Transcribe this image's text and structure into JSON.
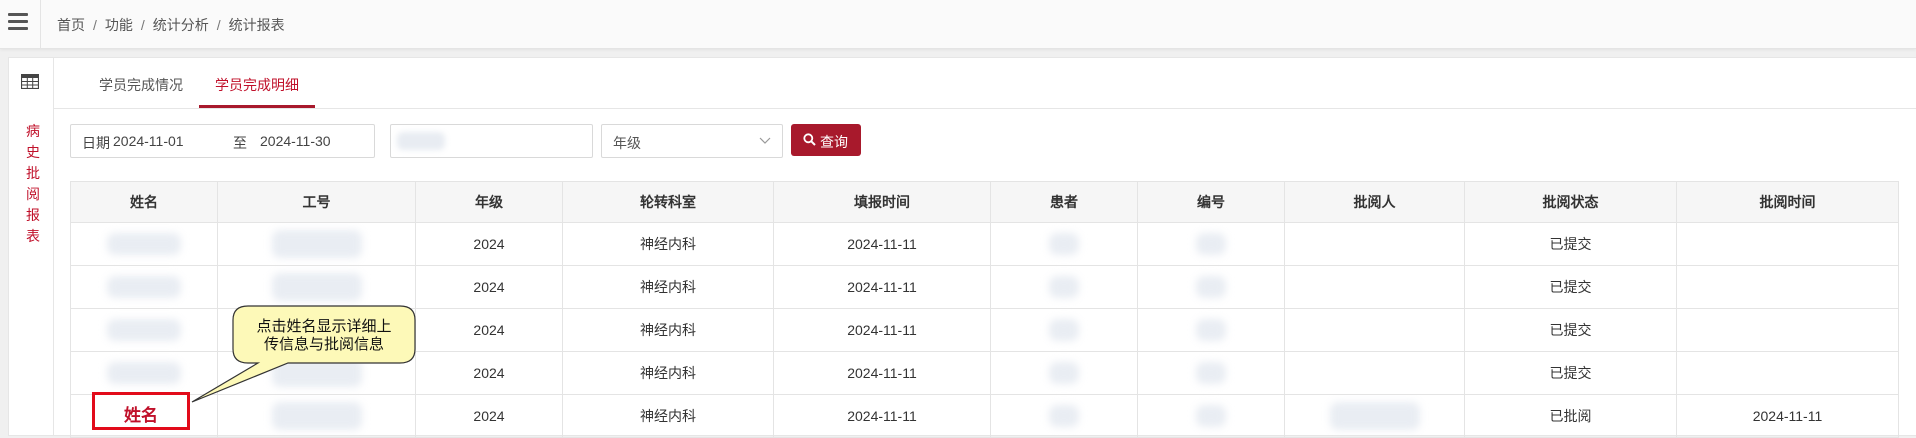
{
  "breadcrumb": [
    "首页",
    "功能",
    "统计分析",
    "统计报表"
  ],
  "sidebar_label": [
    "病",
    "史",
    "批",
    "阅",
    "报",
    "表"
  ],
  "tabs": [
    {
      "label": "学员完成情况",
      "active": false
    },
    {
      "label": "学员完成明细",
      "active": true
    }
  ],
  "filters": {
    "date_label": "日期",
    "date_start": "2024-11-01",
    "date_to": "至",
    "date_end": "2024-11-30",
    "grade_placeholder": "年级",
    "query_label": "查询"
  },
  "table": {
    "headers": [
      "姓名",
      "工号",
      "年级",
      "轮转科室",
      "填报时间",
      "患者",
      "编号",
      "批阅人",
      "批阅状态",
      "批阅时间"
    ],
    "rows": [
      {
        "grade": "2024",
        "dept": "神经内科",
        "time": "2024-11-11",
        "status": "已提交",
        "review_time": ""
      },
      {
        "grade": "2024",
        "dept": "神经内科",
        "time": "2024-11-11",
        "status": "已提交",
        "review_time": ""
      },
      {
        "grade": "2024",
        "dept": "神经内科",
        "time": "2024-11-11",
        "status": "已提交",
        "review_time": ""
      },
      {
        "grade": "2024",
        "dept": "神经内科",
        "time": "2024-11-11",
        "status": "已提交",
        "review_time": ""
      },
      {
        "grade": "2024",
        "dept": "神经内科",
        "time": "2024-11-11",
        "status": "已批阅",
        "review_time": "2024-11-11"
      }
    ]
  },
  "annotation": {
    "highlight_label": "姓名",
    "callout_line1": "点击姓名显示详细上",
    "callout_line2": "传信息与批阅信息"
  },
  "colors": {
    "accent": "#a8192c",
    "highlight_border": "#e20b1a",
    "callout_fill": "#fdf9b8"
  }
}
